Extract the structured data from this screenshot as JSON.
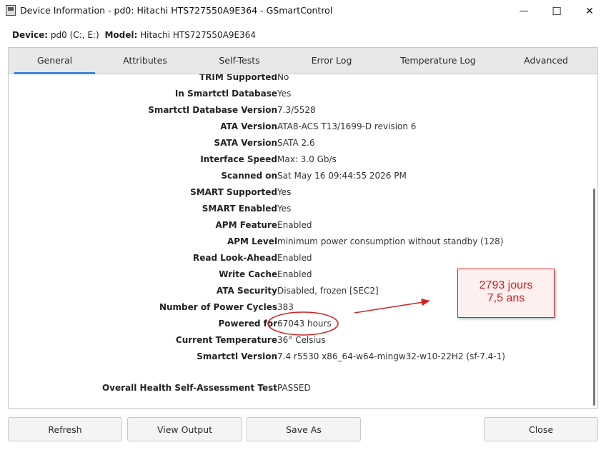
{
  "window": {
    "title": "Device Information - pd0: Hitachi HTS727550A9E364 - GSmartControl",
    "minimize_glyph": "—",
    "maximize_glyph": "☐",
    "close_glyph": "✕"
  },
  "device": {
    "device_label": "Device:",
    "device_value": "pd0 (C:, E:)",
    "model_label": "Model:",
    "model_value": "Hitachi HTS727550A9E364"
  },
  "tabs": [
    {
      "label": "General",
      "active": true
    },
    {
      "label": "Attributes"
    },
    {
      "label": "Self-Tests"
    },
    {
      "label": "Error Log"
    },
    {
      "label": "Temperature Log"
    },
    {
      "label": "Advanced"
    }
  ],
  "rows": [
    {
      "label": "TRIM Supported",
      "value": "No"
    },
    {
      "label": "In Smartctl Database",
      "value": "Yes"
    },
    {
      "label": "Smartctl Database Version",
      "value": "7.3/5528"
    },
    {
      "label": "ATA Version",
      "value": "ATA8-ACS T13/1699-D revision 6"
    },
    {
      "label": "SATA Version",
      "value": "SATA 2.6"
    },
    {
      "label": "Interface Speed",
      "value": "Max: 3.0 Gb/s"
    },
    {
      "label": "Scanned on",
      "value": "Sat May 16 09:44:55 2026 PM"
    },
    {
      "label": "SMART Supported",
      "value": "Yes"
    },
    {
      "label": "SMART Enabled",
      "value": "Yes"
    },
    {
      "label": "APM Feature",
      "value": "Enabled"
    },
    {
      "label": "APM Level",
      "value": "minimum power consumption without standby (128)"
    },
    {
      "label": "Read Look-Ahead",
      "value": "Enabled"
    },
    {
      "label": "Write Cache",
      "value": "Enabled"
    },
    {
      "label": "ATA Security",
      "value": "Disabled, frozen [SEC2]"
    },
    {
      "label": "Number of Power Cycles",
      "value": "383"
    },
    {
      "label": "Powered for",
      "value": "67043 hours"
    },
    {
      "label": "Current Temperature",
      "value": "36° Celsius"
    },
    {
      "label": "Smartctl Version",
      "value": "7.4 r5530 x86_64-w64-mingw32-w10-22H2 (sf-7.4-1)"
    },
    {
      "label": "Overall Health Self-Assessment Test",
      "value": "PASSED"
    }
  ],
  "buttons": {
    "refresh": "Refresh",
    "view_output": "View Output",
    "save_as": "Save As",
    "close": "Close"
  },
  "annotation": {
    "line1": "2793 jours",
    "line2": "7,5 ans",
    "color": "#d42020"
  }
}
